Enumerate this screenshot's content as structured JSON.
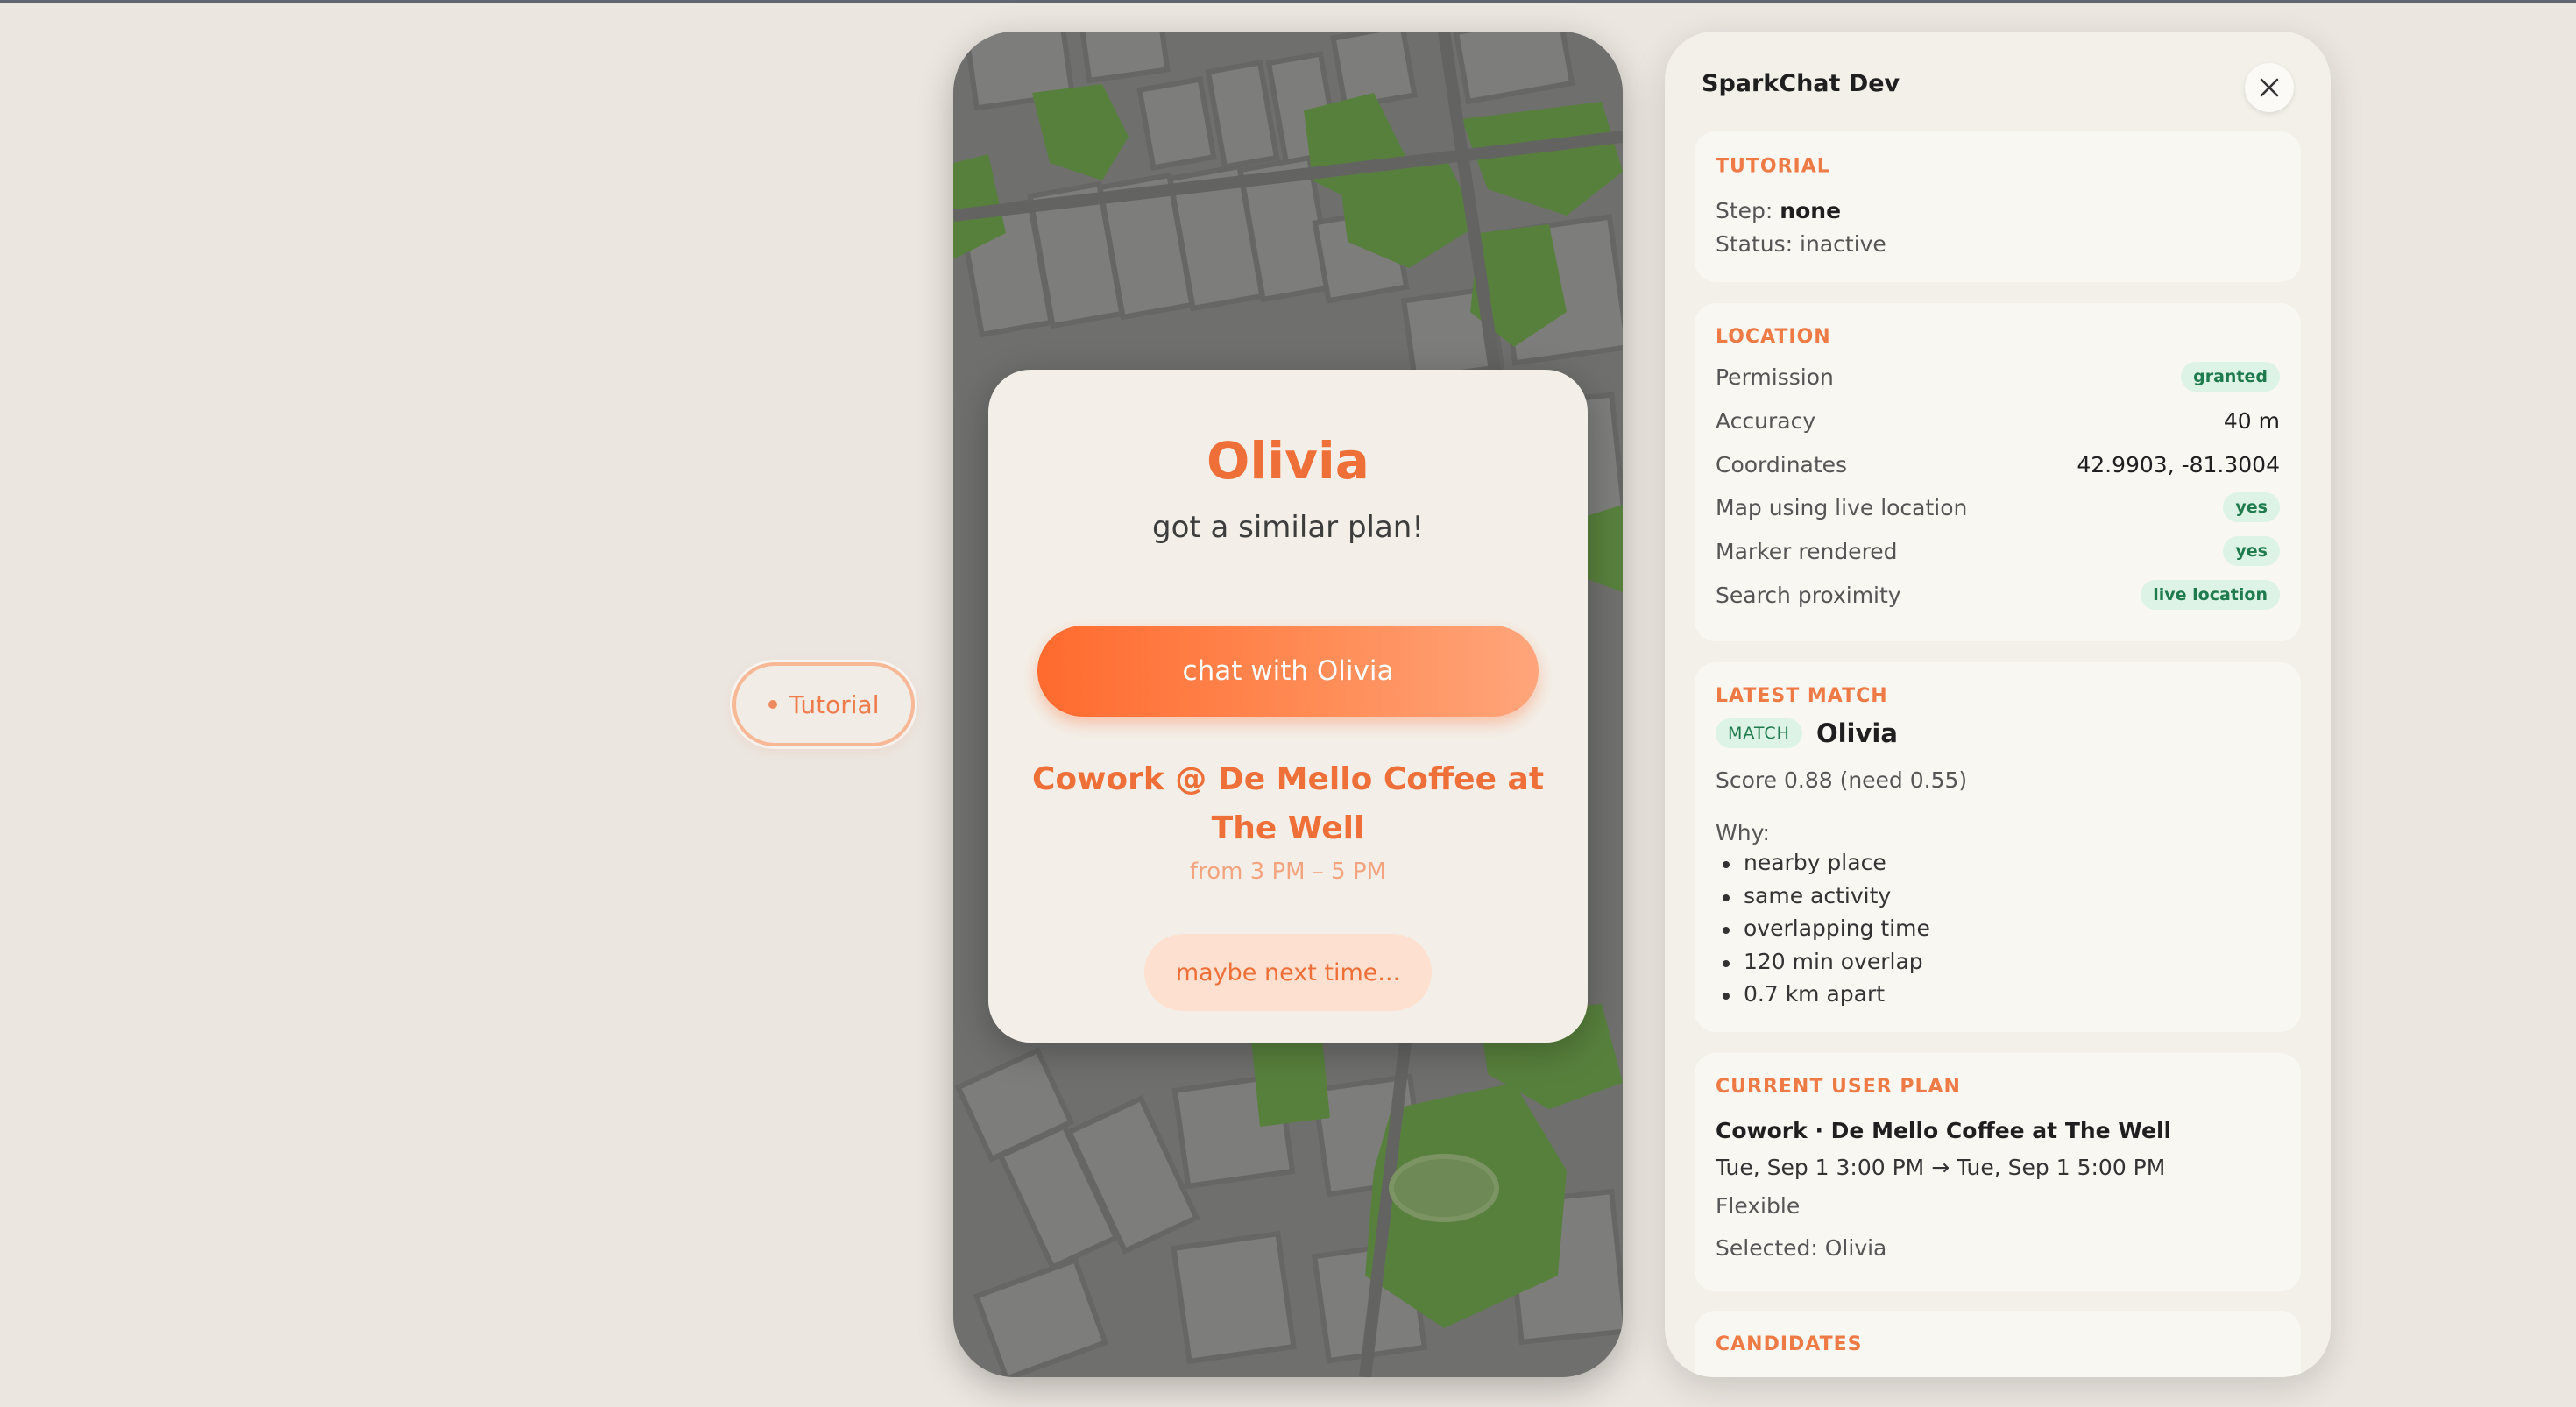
{
  "tutorial_button": {
    "label": "Tutorial"
  },
  "match_card": {
    "name": "Olivia",
    "subtitle": "got a similar plan!",
    "chat_button": "chat with Olivia",
    "plan_title": "Cowork @ De Mello Coffee at The Well",
    "plan_time": "from 3 PM – 5 PM",
    "dismiss_button": "maybe next time..."
  },
  "dev_panel": {
    "title": "SparkChat Dev",
    "tutorial": {
      "heading": "TUTORIAL",
      "step_label": "Step: ",
      "step_value": "none",
      "status": "Status: inactive"
    },
    "location": {
      "heading": "LOCATION",
      "rows": [
        {
          "label": "Permission",
          "value": "granted",
          "kind": "badge"
        },
        {
          "label": "Accuracy",
          "value": "40 m",
          "kind": "text"
        },
        {
          "label": "Coordinates",
          "value": "42.9903, -81.3004",
          "kind": "text"
        },
        {
          "label": "Map using live location",
          "value": "yes",
          "kind": "badge"
        },
        {
          "label": "Marker rendered",
          "value": "yes",
          "kind": "badge"
        },
        {
          "label": "Search proximity",
          "value": "live location",
          "kind": "badge"
        }
      ]
    },
    "latest_match": {
      "heading": "LATEST MATCH",
      "badge": "MATCH",
      "name": "Olivia",
      "score": "Score 0.88 (need 0.55)",
      "why_label": "Why:",
      "reasons": [
        "nearby place",
        "same activity",
        "overlapping time",
        "120 min overlap",
        "0.7 km apart"
      ]
    },
    "current_plan": {
      "heading": "CURRENT USER PLAN",
      "title": "Cowork · De Mello Coffee at The Well",
      "time": "Tue, Sep 1 3:00 PM → Tue, Sep 1 5:00 PM",
      "flexibility": "Flexible",
      "selected": "Selected: Olivia"
    },
    "candidates": {
      "heading": "CANDIDATES"
    }
  },
  "colors": {
    "accent": "#ee6f37",
    "badge_bg": "#dcf3e6",
    "badge_text": "#1f7a4d",
    "map_park": "#5f8f3e",
    "map_block": "#8a8a88"
  },
  "icons": {
    "close": "close-icon",
    "tutorial_dot": "dot-icon"
  }
}
